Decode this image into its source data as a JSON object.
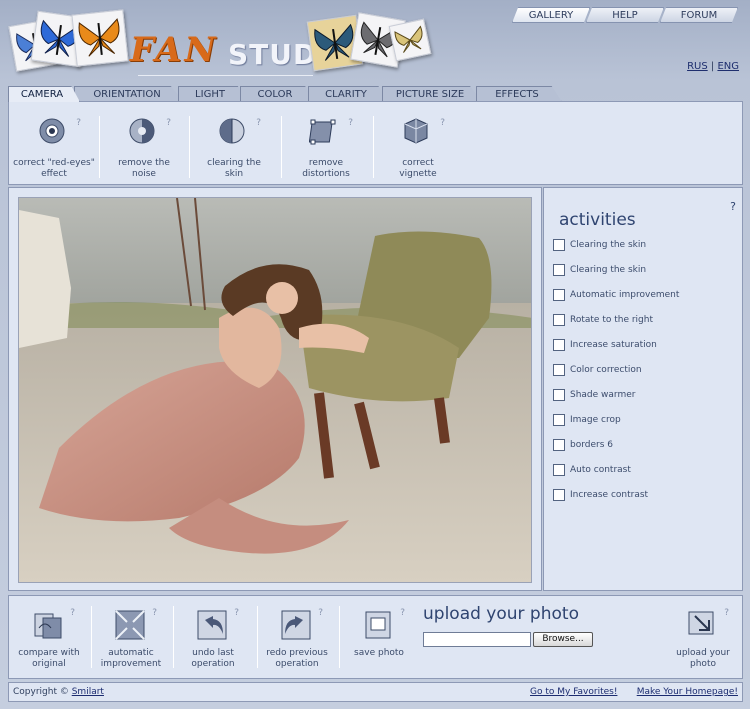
{
  "logo": {
    "fan": "FAN",
    "studio": "STUDIO"
  },
  "topnav": [
    "GALLERY",
    "HELP",
    "FORUM"
  ],
  "lang": {
    "rus": "RUS",
    "sep": "|",
    "eng": "ENG"
  },
  "tool_tabs": [
    "CAMERA",
    "ORIENTATION",
    "LIGHT",
    "COLOR",
    "CLARITY",
    "PICTURE SIZE",
    "EFFECTS"
  ],
  "tools": [
    {
      "l1": "correct \"red-eyes\"",
      "l2": "effect",
      "icon": "eye-icon"
    },
    {
      "l1": "remove the",
      "l2": "noise",
      "icon": "noise-icon"
    },
    {
      "l1": "clearing the",
      "l2": "skin",
      "icon": "skin-icon"
    },
    {
      "l1": "remove",
      "l2": "distortions",
      "icon": "distortion-icon"
    },
    {
      "l1": "correct",
      "l2": "vignette",
      "icon": "vignette-icon"
    }
  ],
  "help_mark": "?",
  "activities": {
    "title": "activities",
    "help": "?",
    "items": [
      "Clearing the skin",
      "Clearing the skin",
      "Automatic improvement",
      "Rotate to the right",
      "Increase saturation",
      "Color correction",
      "Shade warmer",
      "Image crop",
      "borders 6",
      "Auto contrast",
      "Increase contrast"
    ]
  },
  "bottom_tools": [
    {
      "l1": "compare with",
      "l2": "original",
      "icon": "compare-icon"
    },
    {
      "l1": "automatic",
      "l2": "improvement",
      "icon": "auto-improve-icon"
    },
    {
      "l1": "undo last",
      "l2": "operation",
      "icon": "undo-icon"
    },
    {
      "l1": "redo previous",
      "l2": "operation",
      "icon": "redo-icon"
    },
    {
      "l1": "save photo",
      "l2": "",
      "icon": "save-icon"
    }
  ],
  "upload": {
    "title": "upload your photo",
    "browse": "Browse...",
    "button_l1": "upload your",
    "button_l2": "photo"
  },
  "footer": {
    "copyright": "Copyright ©",
    "brand": "Smilart",
    "favorites": "Go to My Favorites!",
    "homepage": "Make Your Homepage!"
  }
}
